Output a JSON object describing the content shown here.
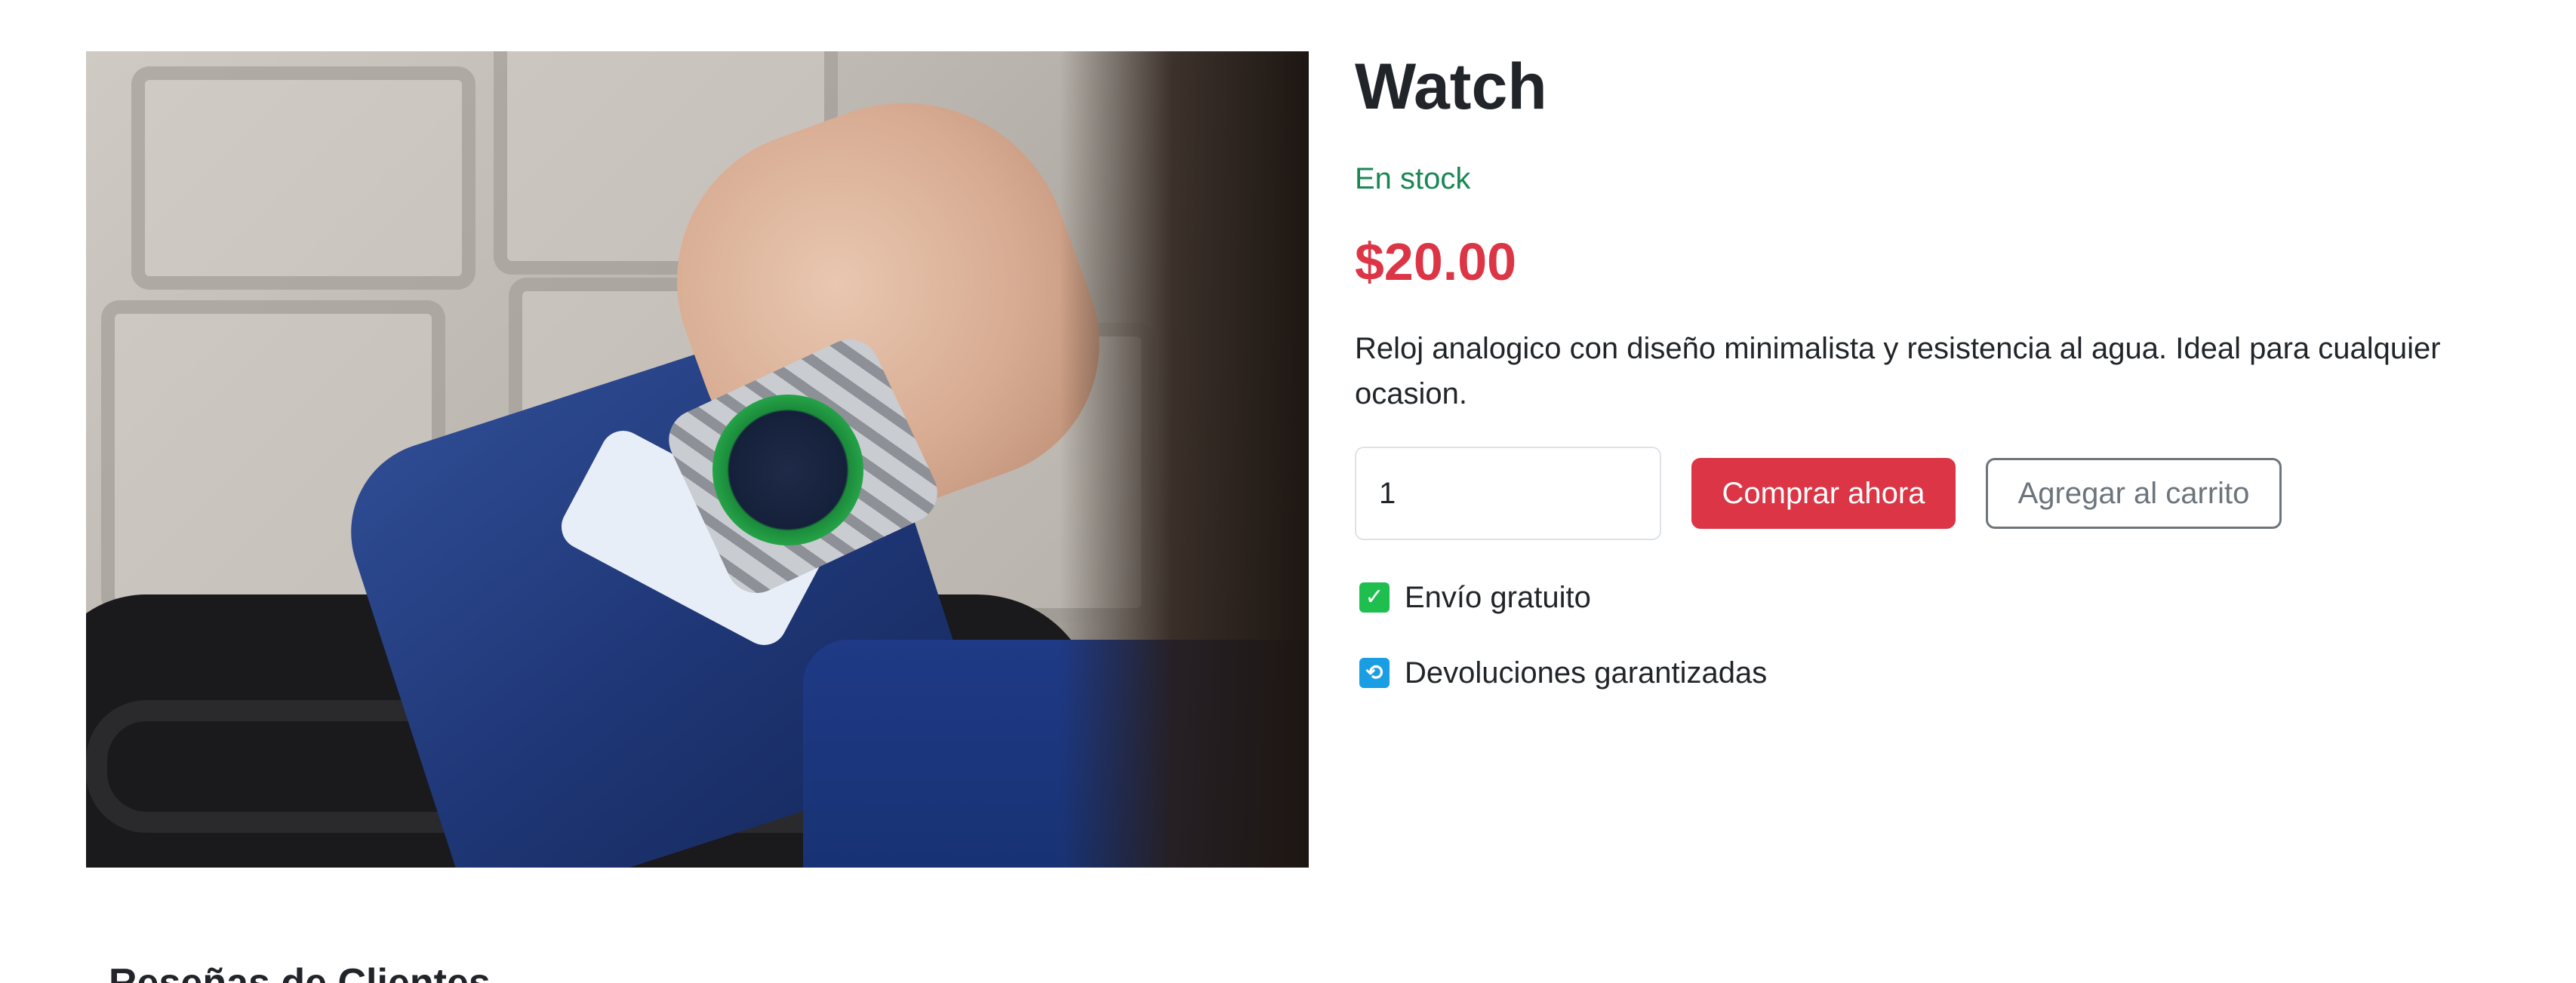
{
  "product": {
    "title": "Watch",
    "stock_status": "En stock",
    "price": "$20.00",
    "description": "Reloj analogico con diseño minimalista y resistencia al agua. Ideal para cualquier ocasion.",
    "image_alt": "Watch"
  },
  "purchase": {
    "quantity_value": "1",
    "buy_now_label": "Comprar ahora",
    "add_to_cart_label": "Agregar al carrito"
  },
  "features": [
    {
      "icon": "check-icon",
      "label": "Envío gratuito"
    },
    {
      "icon": "return-icon",
      "label": "Devoluciones garantizadas"
    }
  ],
  "reviews": {
    "heading": "Reseñas de Clientes"
  },
  "colors": {
    "in_stock": "#198754",
    "price": "#dc3545",
    "buy_button": "#dc3545",
    "cart_button_border": "#6c757d"
  }
}
